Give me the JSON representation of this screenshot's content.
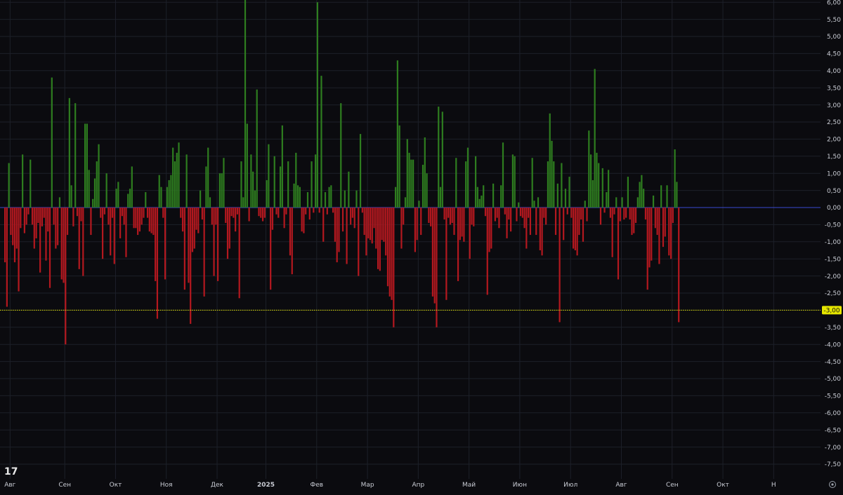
{
  "chart_data": {
    "type": "bar",
    "ylim": [
      -7.9,
      6.1
    ],
    "grid": true,
    "y_ticks": [
      "6,00",
      "5,50",
      "5,00",
      "4,50",
      "4,00",
      "3,50",
      "3,00",
      "2,50",
      "2,00",
      "1,50",
      "1,00",
      "0,50",
      "0,00",
      "-0,50",
      "-1,00",
      "-1,50",
      "-2,00",
      "-2,50",
      "-3,00",
      "-3,50",
      "-4,00",
      "-4,50",
      "-5,00",
      "-5,50",
      "-6,00",
      "-6,50",
      "-7,00",
      "-7,50"
    ],
    "y_tick_values": [
      6,
      5.5,
      5,
      4.5,
      4,
      3.5,
      3,
      2.5,
      2,
      1.5,
      1,
      0.5,
      0,
      -0.5,
      -1,
      -1.5,
      -2,
      -2.5,
      -3,
      -3.5,
      -4,
      -4.5,
      -5,
      -5.5,
      -6,
      -6.5,
      -7,
      -7.5
    ],
    "x_labels": [
      "Авг",
      "Сен",
      "Окт",
      "Ноя",
      "Дек",
      "2025",
      "Фев",
      "Мар",
      "Апр",
      "Май",
      "Июн",
      "Июл",
      "Авг",
      "Сен",
      "Окт",
      "Н"
    ],
    "x_label_index": [
      3,
      31,
      57,
      83,
      109,
      134,
      160,
      186,
      212,
      238,
      264,
      290,
      316,
      342,
      368,
      394
    ],
    "reference_line": {
      "value": -3.0,
      "label": "-3,00",
      "color": "#e6e600"
    },
    "colors": {
      "positive": "#2e7d1f",
      "negative": "#b3181f",
      "zero_line": "#3a4ad0",
      "grid": "#1d2029"
    },
    "values": [
      -1.6,
      -2.9,
      1.3,
      -0.8,
      -1.1,
      -1.6,
      -1.2,
      -2.45,
      -0.6,
      1.55,
      -0.75,
      -0.5,
      -0.2,
      1.4,
      -0.5,
      -1.2,
      -0.9,
      -0.45,
      -1.9,
      -0.55,
      -0.3,
      -1.55,
      -0.7,
      -2.35,
      3.8,
      -0.5,
      -1.2,
      -1.1,
      0.3,
      -2.1,
      -2.2,
      -4.0,
      -0.8,
      3.2,
      0.65,
      -0.55,
      3.05,
      -0.25,
      -1.8,
      -0.4,
      -2.0,
      2.45,
      2.45,
      1.1,
      -0.8,
      0.25,
      0.85,
      1.35,
      1.85,
      -0.3,
      -1.5,
      -0.2,
      1.0,
      -0.5,
      -1.4,
      -0.3,
      -1.65,
      0.55,
      0.75,
      -0.9,
      -0.25,
      -0.5,
      -1.45,
      0.4,
      0.55,
      1.2,
      -0.6,
      -0.6,
      -0.8,
      -0.7,
      -0.5,
      -0.3,
      0.45,
      -0.3,
      -0.7,
      -0.75,
      -0.8,
      -2.15,
      -3.25,
      0.95,
      0.6,
      -0.3,
      -2.1,
      0.6,
      0.8,
      0.95,
      1.75,
      1.35,
      1.6,
      1.9,
      -0.3,
      -0.7,
      -2.4,
      1.55,
      -2.2,
      -3.4,
      -1.3,
      -1.2,
      -0.65,
      -0.75,
      0.5,
      -0.35,
      -2.6,
      1.2,
      1.75,
      0.3,
      -0.5,
      -2.0,
      -0.5,
      -2.15,
      1.0,
      1.0,
      1.45,
      -0.45,
      -1.5,
      -1.2,
      -0.25,
      -0.3,
      -0.7,
      -0.2,
      -2.65,
      1.35,
      0.3,
      6.3,
      2.45,
      -0.4,
      1.55,
      1.05,
      0.5,
      3.45,
      -0.25,
      -0.3,
      -0.4,
      -0.3,
      0.8,
      1.85,
      -2.4,
      -0.65,
      1.5,
      -0.2,
      -0.3,
      1.2,
      2.4,
      -0.6,
      -0.2,
      1.35,
      -1.4,
      -1.95,
      0.7,
      1.6,
      0.65,
      0.6,
      -0.7,
      -0.75,
      -0.2,
      0.45,
      -0.35,
      1.35,
      -0.15,
      1.55,
      6.0,
      -0.15,
      3.85,
      -1.0,
      0.45,
      -0.2,
      0.6,
      0.65,
      -0.15,
      -1.0,
      -1.6,
      -1.3,
      3.05,
      -0.7,
      0.5,
      -1.65,
      1.05,
      -0.5,
      -0.3,
      -0.6,
      0.5,
      -2.0,
      2.15,
      -0.15,
      -0.8,
      -1.4,
      -0.9,
      -0.95,
      -1.05,
      -0.6,
      -1.2,
      -1.8,
      -1.85,
      -0.95,
      -1.0,
      -1.4,
      -2.3,
      -2.6,
      -2.7,
      -3.5,
      0.6,
      4.3,
      2.4,
      -1.2,
      -0.5,
      0.3,
      2.0,
      1.6,
      1.4,
      1.4,
      -1.3,
      -0.95,
      0.2,
      -0.8,
      1.25,
      2.05,
      1.0,
      -0.45,
      -0.55,
      -2.6,
      -2.8,
      -3.5,
      2.95,
      0.6,
      2.8,
      -0.35,
      -2.7,
      -0.3,
      -0.5,
      -0.45,
      -0.8,
      1.45,
      -2.15,
      -0.95,
      -0.85,
      -1.0,
      1.35,
      1.75,
      -1.5,
      -0.5,
      -0.55,
      1.5,
      0.6,
      0.25,
      0.35,
      0.65,
      -0.25,
      -2.55,
      -1.3,
      -1.2,
      0.7,
      -0.4,
      -0.3,
      -0.6,
      0.65,
      1.9,
      -0.2,
      -0.9,
      -0.35,
      -0.7,
      1.55,
      1.5,
      -0.4,
      0.15,
      -0.25,
      -0.3,
      -0.6,
      -1.2,
      -0.3,
      -0.8,
      1.45,
      0.2,
      -0.8,
      0.3,
      -1.25,
      -1.4,
      -0.3,
      -0.5,
      1.35,
      2.75,
      1.95,
      1.35,
      -0.8,
      0.7,
      -3.35,
      1.3,
      -0.95,
      0.55,
      -0.2,
      0.9,
      -0.3,
      -1.2,
      -1.25,
      -1.4,
      -0.8,
      -0.35,
      -1.0,
      0.2,
      -0.4,
      2.25,
      1.55,
      0.8,
      4.05,
      1.6,
      1.3,
      -0.5,
      1.15,
      -0.15,
      0.45,
      1.1,
      -0.3,
      -1.45,
      -0.2,
      0.3,
      -2.1,
      -0.4,
      0.3,
      -0.35,
      -0.3,
      0.9,
      -0.35,
      -0.8,
      -0.75,
      -0.45,
      0.3,
      0.75,
      0.95,
      0.55,
      -0.35,
      -2.4,
      -1.75,
      -1.55,
      0.35,
      -0.6,
      -0.8,
      -1.65,
      0.65,
      -1.15,
      -0.85,
      0.65,
      -1.4,
      -1.5,
      -0.45,
      1.7,
      0.75,
      -3.35
    ],
    "watermark": "17",
    "settings_icon": "gear-icon"
  }
}
